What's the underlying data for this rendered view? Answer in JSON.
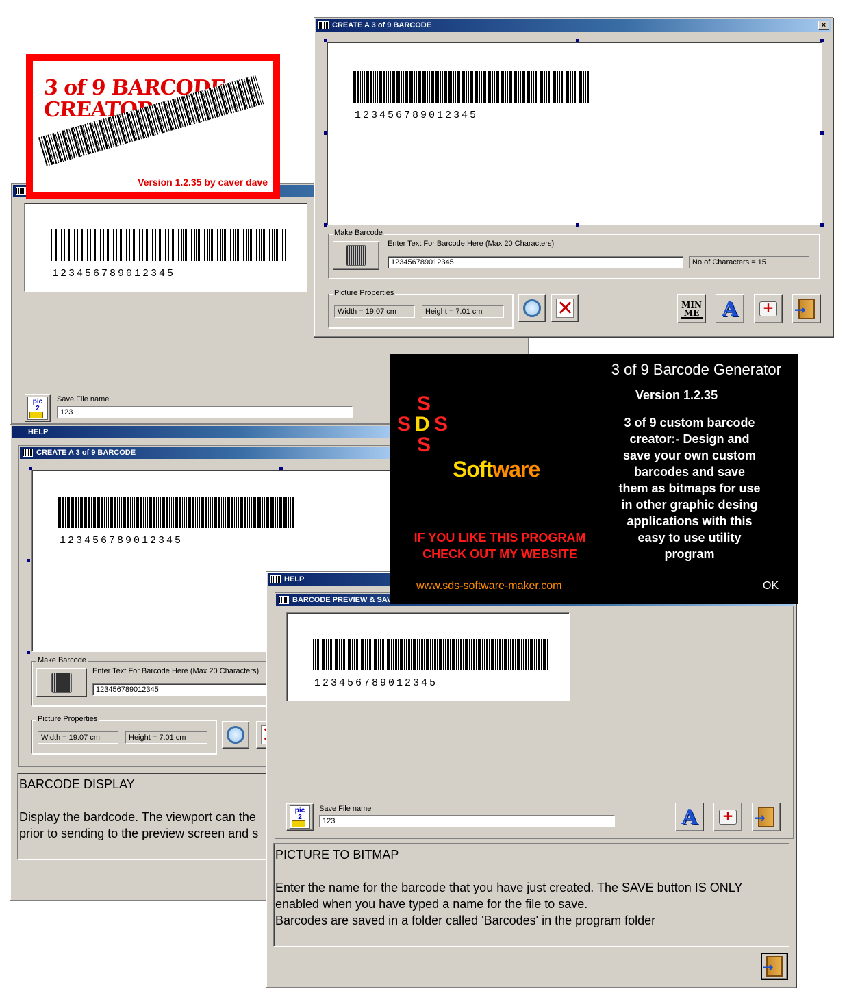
{
  "logo": {
    "title_line1": "3 of 9 BARCODE",
    "title_line2": "CREATOR",
    "version": "Version 1.2.35 by caver dave"
  },
  "win_create_top": {
    "title": "CREATE A 3 of 9 BARCODE",
    "close_glyph": "×",
    "barcode_number": "123456789012345",
    "make_barcode_group": "Make Barcode",
    "enter_text_label": "Enter Text For Barcode Here (Max 20 Characters)",
    "text_value": "123456789012345",
    "char_count": "No of Characters = 15",
    "picture_properties_group": "Picture Properties",
    "width_field": "Width =  19.07 cm",
    "height_field": "Height = 7.01 cm",
    "minme_label": "MIN\nME"
  },
  "win_preview_back": {
    "barcode_number": "123456789012345",
    "save_label": "Save File name",
    "save_value": "123"
  },
  "help_left": {
    "title": "HELP",
    "inner_title": "CREATE A 3 of 9 BARCODE",
    "barcode_number": "123456789012345",
    "make_barcode_group": "Make Barcode",
    "enter_text_label": "Enter Text For Barcode Here (Max 20 Characters)",
    "text_value": "123456789012345",
    "picture_properties_group": "Picture Properties",
    "width_field": "Width =  19.07 cm",
    "height_field": "Height = 7.01 cm",
    "help_heading": "BARCODE DISPLAY",
    "help_line1": "Display the bardcode. The viewport can the",
    "help_line2": "prior to sending to the preview screen and s"
  },
  "help_right": {
    "title": "HELP",
    "inner_title": "BARCODE PREVIEW & SAVE",
    "barcode_number": "123456789012345",
    "save_label": "Save File name",
    "save_value": "123",
    "help_heading": "PICTURE TO BITMAP",
    "help_line1": "Enter the name for the barcode that you have just created. The SAVE button IS ONLY",
    "help_line2": "enabled when you have typed a name for the file to save.",
    "help_line3": "Barcodes are saved in a folder called  'Barcodes' in the program folder"
  },
  "about": {
    "title": "3 of 9 Barcode Generator",
    "version": "Version 1.2.35",
    "description": [
      "3 of 9 custom barcode",
      "creator:- Design and",
      "save your own custom",
      "barcodes and save",
      "them as bitmaps for use",
      "in other graphic desing",
      "applications with this",
      "easy to use utility",
      "program"
    ],
    "sds_letters": [
      "S",
      "S",
      "D",
      "S",
      "S"
    ],
    "software_left": "Soft",
    "software_right": "ware",
    "promo_line1": "IF YOU LIKE THIS PROGRAM",
    "promo_line2": "CHECK OUT MY WEBSITE",
    "website": "www.sds-software-maker.com",
    "ok": "OK"
  },
  "pic_icon_text": "pic\n2\nbmp",
  "colors": {
    "title_bar": "#0a246a",
    "window_face": "#d4d0c8",
    "logo_red": "#ff0000",
    "about_bg": "#000000",
    "promo_red": "#ff1a1a",
    "website_orange": "#ff8c00",
    "sds_red": "#ff2020",
    "sds_yellow": "#ffd700"
  }
}
